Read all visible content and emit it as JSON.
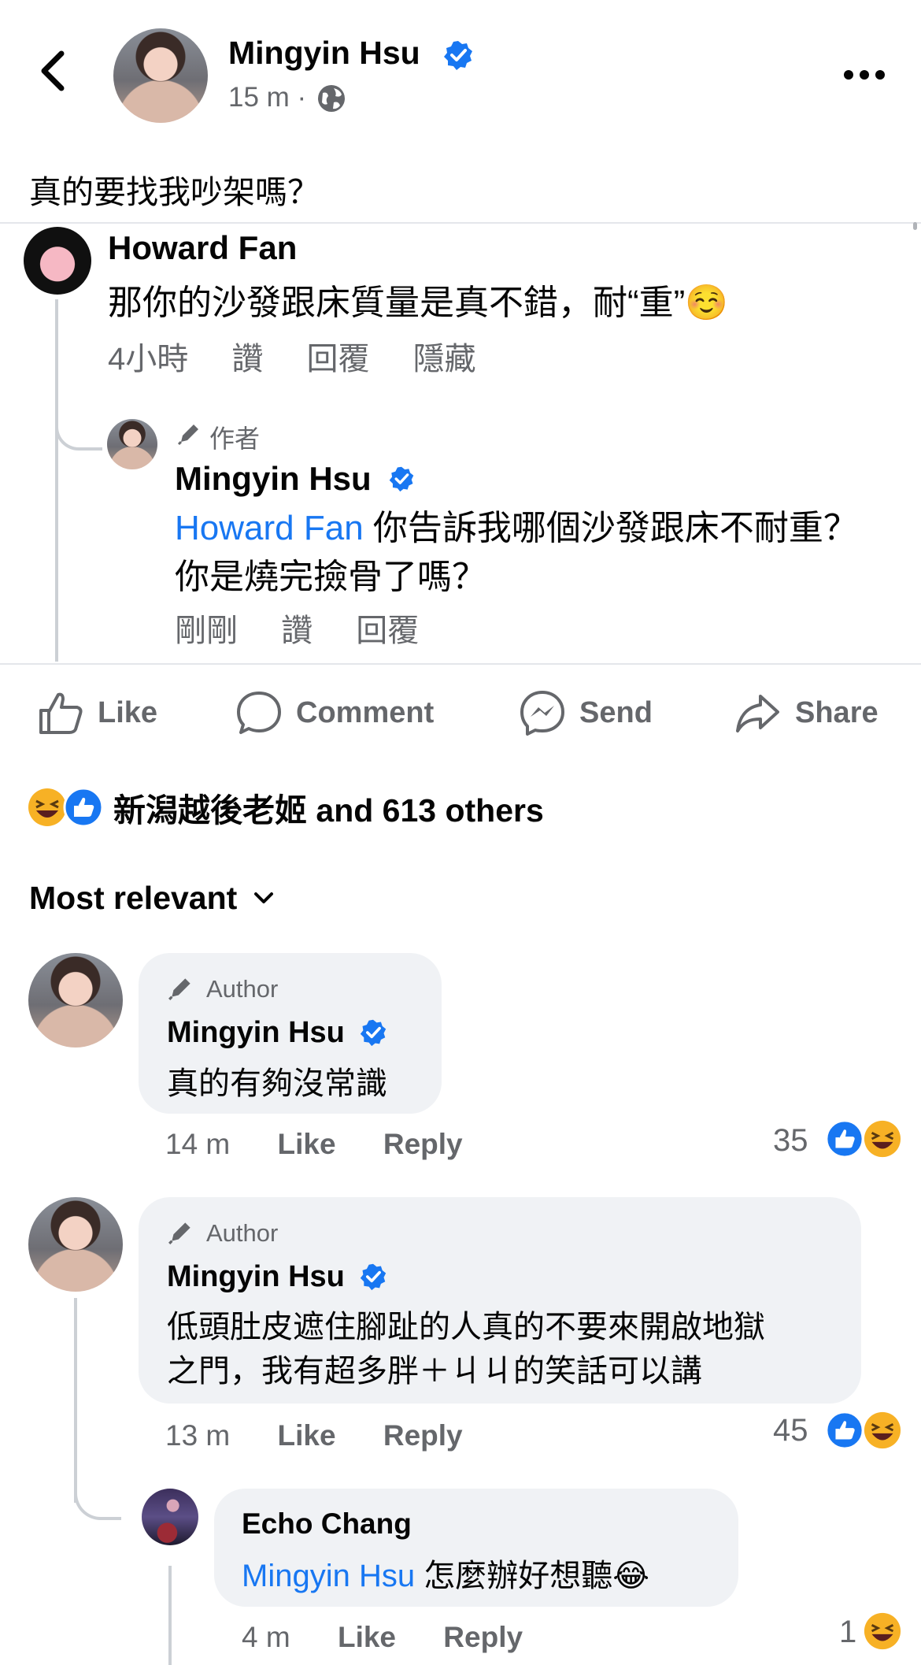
{
  "header": {
    "author_name": "Mingyin Hsu",
    "time": "15 m ·",
    "post_text": "真的要找我吵架嗎？"
  },
  "embedded": {
    "comment1": {
      "name": "Howard Fan",
      "text": "那你的沙發跟床質量是真不錯，耐“重”☺️",
      "time": "4小時",
      "like": "讚",
      "reply": "回覆",
      "hide": "隱藏"
    },
    "reply1": {
      "badge": "作者",
      "name": "Mingyin Hsu",
      "mention": "Howard Fan",
      "text": " 你告訴我哪個沙發跟床不耐重？你是燒完撿骨了嗎？",
      "time": "剛剛",
      "like": "讚",
      "reply": "回覆"
    }
  },
  "actions": {
    "like": "Like",
    "comment": "Comment",
    "send": "Send",
    "share": "Share"
  },
  "reactions_summary": "新潟越後老姬 and 613 others",
  "sort": {
    "label": "Most relevant"
  },
  "comments": [
    {
      "badge": "Author",
      "name": "Mingyin Hsu",
      "text": "真的有夠沒常識",
      "time": "14 m",
      "like": "Like",
      "reply": "Reply",
      "reaction_count": "35"
    },
    {
      "badge": "Author",
      "name": "Mingyin Hsu",
      "text_line1": "低頭肚皮遮住腳趾的人真的不要來開啟地獄",
      "text_line2": "之門，我有超多胖＋ㄐㄐ的笑話可以講",
      "time": "13 m",
      "like": "Like",
      "reply": "Reply",
      "reaction_count": "45"
    }
  ],
  "reply": {
    "name": "Echo Chang",
    "mention": "Mingyin Hsu",
    "text": " 怎麼辦好想聽😂",
    "time": "4 m",
    "like": "Like",
    "reply": "Reply",
    "reaction_count": "1"
  },
  "colors": {
    "accent": "#1877f2",
    "secondary_text": "#65676b",
    "bubble": "#f0f2f5"
  },
  "icons": [
    "back-arrow-icon",
    "globe-icon",
    "more-icon",
    "verified-badge-icon",
    "pencil-icon",
    "like-icon",
    "comment-icon",
    "messenger-icon",
    "share-icon",
    "chevron-down-icon",
    "like-reaction-icon",
    "haha-reaction-icon"
  ]
}
